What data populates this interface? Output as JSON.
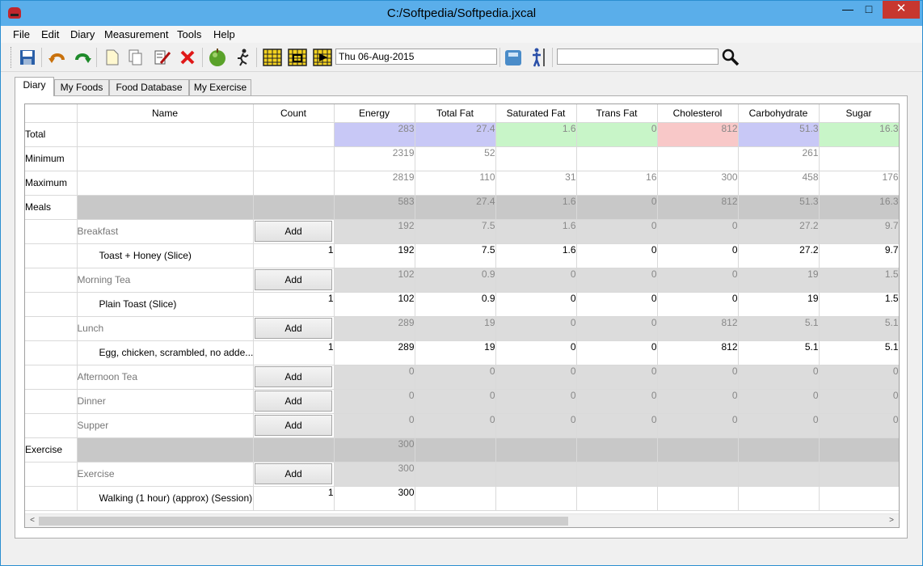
{
  "window": {
    "title": "C:/Softpedia/Softpedia.jxcal",
    "minimize": "—",
    "maximize": "□",
    "close": "✕"
  },
  "menu": [
    "File",
    "Edit",
    "Diary",
    "Measurement",
    "Tools",
    "Help"
  ],
  "toolbar": {
    "icons": [
      "save-icon",
      "undo-icon",
      "redo-icon",
      "new-document-icon",
      "copy-document-icon",
      "edit-icon",
      "delete-icon",
      "apple-icon",
      "runner-icon",
      "calendar-previous-icon",
      "calendar-today-icon",
      "calendar-next-icon",
      "scale-icon",
      "body-measure-icon",
      "search-icon"
    ],
    "date_value": "Thu 06-Aug-2015",
    "search_value": ""
  },
  "tabs": [
    "Diary",
    "My Foods",
    "Food Database",
    "My Exercise"
  ],
  "active_tab": "Diary",
  "colors": {
    "blue": "#c8c8f6",
    "green": "#c8f5c8",
    "red": "#f8c8c8",
    "gray_dark": "#c8c8c8",
    "gray_light": "#dcdcdc"
  },
  "grid": {
    "columns": [
      "Name",
      "Count",
      "Energy",
      "Total Fat",
      "Saturated Fat",
      "Trans Fat",
      "Cholesterol",
      "Carbohydrate",
      "Sugar"
    ],
    "rows": [
      {
        "header": "Total",
        "name": "",
        "count": "",
        "values": [
          "283",
          "27.4",
          "1.6",
          "0",
          "812",
          "51.3",
          "16.3"
        ]
      },
      {
        "header": "Minimum",
        "name": "",
        "count": "",
        "values": [
          "2319",
          "52",
          "",
          "",
          "",
          "261",
          ""
        ]
      },
      {
        "header": "Maximum",
        "name": "",
        "count": "",
        "values": [
          "2819",
          "110",
          "31",
          "16",
          "300",
          "458",
          "176"
        ]
      },
      {
        "header": "Meals",
        "name": "",
        "count": "",
        "values": [
          "583",
          "27.4",
          "1.6",
          "0",
          "812",
          "51.3",
          "16.3"
        ]
      },
      {
        "header": "",
        "name": "Breakfast",
        "count": "",
        "add": "Add",
        "values": [
          "192",
          "7.5",
          "1.6",
          "0",
          "0",
          "27.2",
          "9.7"
        ]
      },
      {
        "header": "",
        "name": "Toast + Honey (Slice)",
        "count": "1",
        "values": [
          "192",
          "7.5",
          "1.6",
          "0",
          "0",
          "27.2",
          "9.7"
        ]
      },
      {
        "header": "",
        "name": "Morning Tea",
        "count": "",
        "add": "Add",
        "values": [
          "102",
          "0.9",
          "0",
          "0",
          "0",
          "19",
          "1.5"
        ]
      },
      {
        "header": "",
        "name": "Plain Toast (Slice)",
        "count": "1",
        "values": [
          "102",
          "0.9",
          "0",
          "0",
          "0",
          "19",
          "1.5"
        ]
      },
      {
        "header": "",
        "name": "Lunch",
        "count": "",
        "add": "Add",
        "values": [
          "289",
          "19",
          "0",
          "0",
          "812",
          "5.1",
          "5.1"
        ]
      },
      {
        "header": "",
        "name": "Egg, chicken, scrambled, no adde...",
        "count": "1",
        "values": [
          "289",
          "19",
          "0",
          "0",
          "812",
          "5.1",
          "5.1"
        ]
      },
      {
        "header": "",
        "name": "Afternoon Tea",
        "count": "",
        "add": "Add",
        "values": [
          "0",
          "0",
          "0",
          "0",
          "0",
          "0",
          "0"
        ]
      },
      {
        "header": "",
        "name": "Dinner",
        "count": "",
        "add": "Add",
        "values": [
          "0",
          "0",
          "0",
          "0",
          "0",
          "0",
          "0"
        ]
      },
      {
        "header": "",
        "name": "Supper",
        "count": "",
        "add": "Add",
        "values": [
          "0",
          "0",
          "0",
          "0",
          "0",
          "0",
          "0"
        ]
      },
      {
        "header": "Exercise",
        "name": "",
        "count": "",
        "values": [
          "300",
          "",
          "",
          "",
          "",
          "",
          ""
        ]
      },
      {
        "header": "",
        "name": "Exercise",
        "count": "",
        "add": "Add",
        "values": [
          "300",
          "",
          "",
          "",
          "",
          "",
          ""
        ]
      },
      {
        "header": "",
        "name": "Walking (1 hour) (approx) (Session)",
        "count": "1",
        "values": [
          "300",
          "",
          "",
          "",
          "",
          "",
          ""
        ]
      }
    ]
  },
  "scrollbar": {
    "left_arrow": "<",
    "right_arrow": ">"
  }
}
